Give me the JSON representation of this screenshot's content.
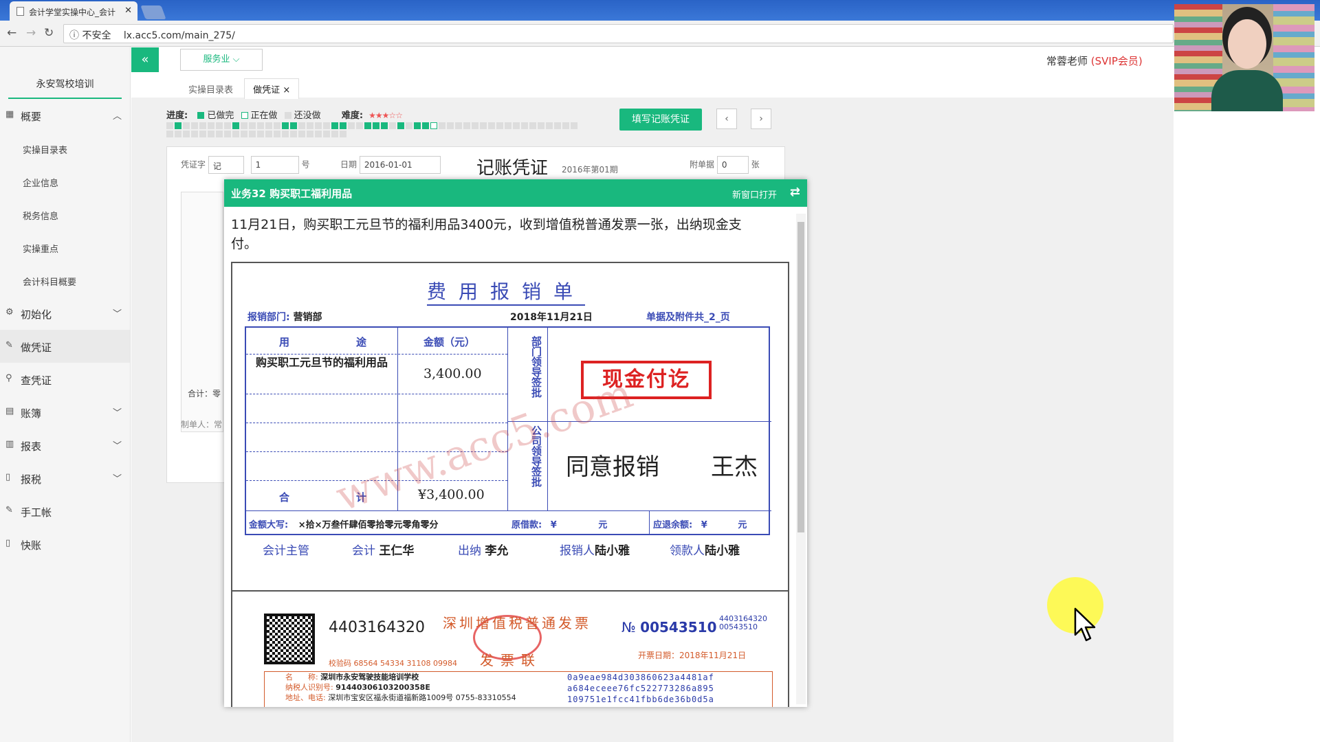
{
  "browser": {
    "tab_title": "会计学堂实操中心_会计",
    "tab_close": "✕",
    "security_label": "不安全",
    "url": "lx.acc5.com/main_275/"
  },
  "sidebar": {
    "org_name": "永安驾校培训",
    "items": [
      {
        "label": "概要",
        "icon": "grid-icon",
        "chevron": "︿"
      },
      {
        "label": "初始化",
        "icon": "gear-icon",
        "chevron": "﹀"
      },
      {
        "label": "做凭证",
        "icon": "pen-icon",
        "chevron": ""
      },
      {
        "label": "查凭证",
        "icon": "search-icon",
        "chevron": ""
      },
      {
        "label": "账簿",
        "icon": "book-icon",
        "chevron": "﹀"
      },
      {
        "label": "报表",
        "icon": "report-icon",
        "chevron": "﹀"
      },
      {
        "label": "报税",
        "icon": "file-icon",
        "chevron": "﹀"
      },
      {
        "label": "手工帐",
        "icon": "pen-icon",
        "chevron": ""
      },
      {
        "label": "快账",
        "icon": "file-icon",
        "chevron": ""
      }
    ],
    "subitems": [
      "实操目录表",
      "企业信息",
      "税务信息",
      "实操重点",
      "会计科目概要"
    ]
  },
  "topbar": {
    "collapse": "«",
    "industry": "服务业 ⌵",
    "teacher": "常蓉老师",
    "vip": "(SVIP会员)"
  },
  "subtabs": {
    "catalog": "实操目录表",
    "current": "做凭证",
    "close": "×"
  },
  "progress": {
    "label": "进度:",
    "done": "已做完",
    "doing": "正在做",
    "todo": "还没做",
    "difficulty_label": "难度:",
    "stars": "★★★☆☆",
    "accent": "#19b87e"
  },
  "actions": {
    "fill_voucher": "填写记账凭证",
    "prev": "‹",
    "next": "›"
  },
  "voucher": {
    "word_label": "凭证字",
    "word_value": "记",
    "number_value": "1",
    "number_unit": "号",
    "date_label": "日期",
    "date_value": "2016-01-01",
    "title": "记账凭证",
    "period": "2016年第01期",
    "attach_label": "附单据",
    "attach_value": "0",
    "attach_unit": "张",
    "total_label": "合计：零",
    "maker_label": "制单人：常"
  },
  "task": {
    "title": "业务32 购买职工福利用品",
    "open_new": "新窗口打开",
    "description": "11月21日，购买职工元旦节的福利用品3400元，收到增值税普通发票一张，出纳现金支付。"
  },
  "expense_form": {
    "title": "费用报销单",
    "dept_label": "报销部门:",
    "dept_value": "营销部",
    "date": "2018年11月21日",
    "attachments": "单据及附件共_2_页",
    "col_use_a": "用",
    "col_use_b": "途",
    "col_amount": "金额（元）",
    "row_item": "购买职工元旦节的福利用品",
    "row_amount": "3,400.00",
    "dept_approve": "部门领导签批",
    "company_approve": "公司领导签批",
    "cash_stamp": "现金付讫",
    "approval_text": "同意报销",
    "approver": "王杰",
    "total_a": "合",
    "total_b": "计",
    "total_amount": "¥3,400.00",
    "words_label": "金额大写:",
    "words_value": "×拾×万叁仟肆佰零拾零元零角零分",
    "orig_loan": "原借款:",
    "orig_loan_unit": "¥",
    "orig_loan_yuan": "元",
    "refund": "应退余额:",
    "refund_unit": "¥",
    "refund_yuan": "元",
    "chief_label": "会计主管",
    "accountant_label": "会计",
    "accountant": "王仁华",
    "cashier_label": "出纳",
    "cashier": "李允",
    "claimant_label": "报销人",
    "claimant": "陆小雅",
    "receiver_label": "领款人",
    "receiver": "陆小雅",
    "watermark": "www.acc5.com"
  },
  "invoice": {
    "code": "4403164320",
    "title": "深圳增值税普通发票",
    "copy": "发票联",
    "no_label": "№",
    "no_value": "00543510",
    "side_code": "4403164320",
    "side_no": "00543510",
    "check_code": "校验码 68564 54334 31108 09984",
    "date": "开票日期：2018年11月21日",
    "buyer_name_label": "名　　称:",
    "buyer_name": "深圳市永安驾驶技能培训学校",
    "buyer_tax_label": "纳税人识别号:",
    "buyer_tax": "91440306103200358E",
    "buyer_addr_label": "地址、电话:",
    "buyer_addr": "深圳市宝安区福永街道福新路1009号 0755-83310554",
    "cipher1": "0a9eae984d303860623a4481af",
    "cipher2": "a684eceee76fc522773286a895",
    "cipher3": "109751e1fcc41fbb6de36b0d5a"
  }
}
